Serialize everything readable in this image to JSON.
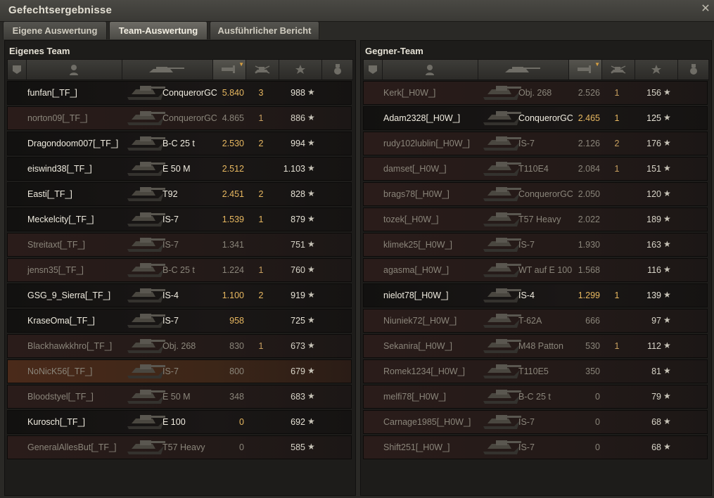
{
  "window": {
    "title": "Gefechtsergebnisse",
    "close_symbol": "✕"
  },
  "tabs": [
    {
      "label": "Eigene Auswertung"
    },
    {
      "label": "Team-Auswertung"
    },
    {
      "label": "Ausführlicher Bericht"
    }
  ],
  "own_team": {
    "title": "Eigenes Team",
    "rows": [
      {
        "name": "funfan[_TF_]",
        "tank": "ConquerorGC",
        "xp": "5.840",
        "kills": "3",
        "score": "988",
        "alive": true
      },
      {
        "name": "norton09[_TF_]",
        "tank": "ConquerorGC",
        "xp": "4.865",
        "kills": "1",
        "score": "886",
        "alive": false
      },
      {
        "name": "Dragondoom007[_TF_]",
        "tank": "B-C 25 t",
        "xp": "2.530",
        "kills": "2",
        "score": "994",
        "alive": true
      },
      {
        "name": "eiswind38[_TF_]",
        "tank": "E 50 M",
        "xp": "2.512",
        "kills": "",
        "score": "1.103",
        "alive": true
      },
      {
        "name": "Easti[_TF_]",
        "tank": "T92",
        "xp": "2.451",
        "kills": "2",
        "score": "828",
        "alive": true
      },
      {
        "name": "Meckelcity[_TF_]",
        "tank": "IS-7",
        "xp": "1.539",
        "kills": "1",
        "score": "879",
        "alive": true
      },
      {
        "name": "Streitaxt[_TF_]",
        "tank": "IS-7",
        "xp": "1.341",
        "kills": "",
        "score": "751",
        "alive": false
      },
      {
        "name": "jensn35[_TF_]",
        "tank": "B-C 25 t",
        "xp": "1.224",
        "kills": "1",
        "score": "760",
        "alive": false
      },
      {
        "name": "GSG_9_Sierra[_TF_]",
        "tank": "IS-4",
        "xp": "1.100",
        "kills": "2",
        "score": "919",
        "alive": true
      },
      {
        "name": "KraseOma[_TF_]",
        "tank": "IS-7",
        "xp": "958",
        "kills": "",
        "score": "725",
        "alive": true
      },
      {
        "name": "Blackhawkkhro[_TF_]",
        "tank": "Obj. 268",
        "xp": "830",
        "kills": "1",
        "score": "673",
        "alive": false
      },
      {
        "name": "NoNicK56[_TF_]",
        "tank": "IS-7",
        "xp": "800",
        "kills": "",
        "score": "679",
        "alive": false,
        "highlight": true
      },
      {
        "name": "Bloodstyel[_TF_]",
        "tank": "E 50 M",
        "xp": "348",
        "kills": "",
        "score": "683",
        "alive": false
      },
      {
        "name": "Kurosch[_TF_]",
        "tank": "E 100",
        "xp": "0",
        "kills": "",
        "score": "692",
        "alive": true
      },
      {
        "name": "GeneralAllesBut[_TF_]",
        "tank": "T57 Heavy",
        "xp": "0",
        "kills": "",
        "score": "585",
        "alive": false
      }
    ]
  },
  "enemy_team": {
    "title": "Gegner-Team",
    "rows": [
      {
        "name": "Kerk[_H0W_]",
        "tank": "Obj. 268",
        "xp": "2.526",
        "kills": "1",
        "score": "156",
        "alive": false
      },
      {
        "name": "Adam2328[_H0W_]",
        "tank": "ConquerorGC",
        "xp": "2.465",
        "kills": "1",
        "score": "125",
        "alive": true
      },
      {
        "name": "rudy102lublin[_H0W_]",
        "tank": "IS-7",
        "xp": "2.126",
        "kills": "2",
        "score": "176",
        "alive": false
      },
      {
        "name": "damset[_H0W_]",
        "tank": "T110E4",
        "xp": "2.084",
        "kills": "1",
        "score": "151",
        "alive": false
      },
      {
        "name": "brags78[_H0W_]",
        "tank": "ConquerorGC",
        "xp": "2.050",
        "kills": "",
        "score": "120",
        "alive": false
      },
      {
        "name": "tozek[_H0W_]",
        "tank": "T57 Heavy",
        "xp": "2.022",
        "kills": "",
        "score": "189",
        "alive": false
      },
      {
        "name": "klimek25[_H0W_]",
        "tank": "IS-7",
        "xp": "1.930",
        "kills": "",
        "score": "163",
        "alive": false
      },
      {
        "name": "agasma[_H0W_]",
        "tank": "WT auf E 100",
        "xp": "1.568",
        "kills": "",
        "score": "116",
        "alive": false
      },
      {
        "name": "nielot78[_H0W_]",
        "tank": "IS-4",
        "xp": "1.299",
        "kills": "1",
        "score": "139",
        "alive": true
      },
      {
        "name": "Niuniek72[_H0W_]",
        "tank": "T-62A",
        "xp": "666",
        "kills": "",
        "score": "97",
        "alive": false
      },
      {
        "name": "Sekanira[_H0W_]",
        "tank": "M48 Patton",
        "xp": "530",
        "kills": "1",
        "score": "112",
        "alive": false
      },
      {
        "name": "Romek1234[_H0W_]",
        "tank": "T110E5",
        "xp": "350",
        "kills": "",
        "score": "81",
        "alive": false
      },
      {
        "name": "melfi78[_H0W_]",
        "tank": "B-C 25 t",
        "xp": "0",
        "kills": "",
        "score": "79",
        "alive": false
      },
      {
        "name": "Carnage1985[_H0W_]",
        "tank": "IS-7",
        "xp": "0",
        "kills": "",
        "score": "68",
        "alive": false
      },
      {
        "name": "Shift251[_H0W_]",
        "tank": "IS-7",
        "xp": "0",
        "kills": "",
        "score": "68",
        "alive": false
      }
    ]
  },
  "columns": [
    {
      "icon": "rank-chevron-icon"
    },
    {
      "icon": "player-icon"
    },
    {
      "icon": "tank-icon"
    },
    {
      "icon": "damage-icon",
      "sorted": true
    },
    {
      "icon": "kills-icon"
    },
    {
      "icon": "star-icon"
    },
    {
      "icon": "medal-icon"
    }
  ],
  "star_symbol": "★",
  "colors": {
    "accent_orange": "#e8b860",
    "dead_text": "#8a857a",
    "alive_text": "#f0ece0"
  }
}
